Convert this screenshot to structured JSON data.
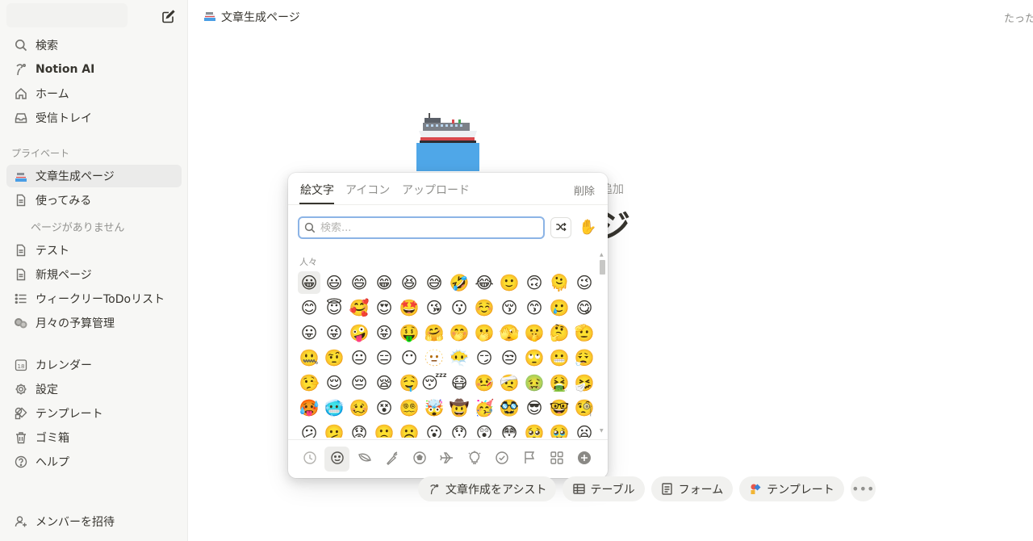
{
  "sidebar": {
    "items": [
      {
        "label": "検索",
        "icon": "search-icon"
      },
      {
        "label": "Notion AI",
        "icon": "notion-ai-icon"
      },
      {
        "label": "ホーム",
        "icon": "home-icon"
      },
      {
        "label": "受信トレイ",
        "icon": "inbox-icon"
      }
    ],
    "private_section": "プライベート",
    "pages": [
      {
        "label": "文章生成ページ",
        "icon": "ship-icon"
      },
      {
        "label": "使ってみる",
        "icon": "page-icon"
      },
      {
        "label": "テスト",
        "icon": "page-icon"
      },
      {
        "label": "新規ページ",
        "icon": "page-icon"
      },
      {
        "label": "ウィークリーToDoリスト",
        "icon": "list-icon"
      },
      {
        "label": "月々の予算管理",
        "icon": "coins-icon"
      }
    ],
    "no_pages": "ページがありません",
    "tools": [
      {
        "label": "カレンダー",
        "icon": "calendar-icon",
        "badge": "18"
      },
      {
        "label": "設定",
        "icon": "gear-icon"
      },
      {
        "label": "テンプレート",
        "icon": "template-icon"
      },
      {
        "label": "ゴミ箱",
        "icon": "trash-icon"
      },
      {
        "label": "ヘルプ",
        "icon": "help-icon"
      }
    ],
    "invite": "メンバーを招待"
  },
  "header": {
    "breadcrumb": "文章生成ページ",
    "right_text": "たった今編集"
  },
  "page": {
    "cover_hint_fragment": "追加",
    "title_fragment": "ジ"
  },
  "picker": {
    "tabs": [
      "絵文字",
      "アイコン",
      "アップロード"
    ],
    "active_tab": 0,
    "remove": "削除",
    "search_placeholder": "検索...",
    "category_label": "人々",
    "emojis": [
      "😀",
      "😃",
      "😄",
      "😁",
      "😆",
      "😅",
      "🤣",
      "😂",
      "🙂",
      "🙃",
      "🫠",
      "😉",
      "😊",
      "😇",
      "🥰",
      "😍",
      "🤩",
      "😘",
      "😗",
      "☺️",
      "😚",
      "😙",
      "🥲",
      "😋",
      "😛",
      "😜",
      "🤪",
      "😝",
      "🤑",
      "🤗",
      "🤭",
      "🫢",
      "🫣",
      "🤫",
      "🤔",
      "🫡",
      "🤐",
      "🤨",
      "😐",
      "😑",
      "😶",
      "🫥",
      "😶‍🌫️",
      "😏",
      "😒",
      "🙄",
      "😬",
      "😮‍💨",
      "🤥",
      "😌",
      "😔",
      "😪",
      "🤤",
      "😴",
      "😷",
      "🤒",
      "🤕",
      "🤢",
      "🤮",
      "🤧",
      "🥵",
      "🥶",
      "🥴",
      "😵",
      "😵‍💫",
      "🤯",
      "🤠",
      "🥳",
      "🥸",
      "😎",
      "🤓",
      "🧐",
      "😕",
      "🫤",
      "😟",
      "🙁",
      "☹️",
      "😮",
      "😯",
      "😲",
      "😳",
      "🥺",
      "🥹",
      "😦"
    ],
    "hand_emoji": "✋",
    "categories": [
      "recent-icon",
      "smiley-icon",
      "leaf-icon",
      "food-icon",
      "ball-icon",
      "plane-icon",
      "bulb-icon",
      "check-icon",
      "flag-icon",
      "grid-icon",
      "plus-circle-icon"
    ]
  },
  "assist": {
    "chips": [
      {
        "label": "文章作成をアシスト",
        "icon": "notion-ai-icon"
      },
      {
        "label": "テーブル",
        "icon": "table-icon"
      },
      {
        "label": "フォーム",
        "icon": "form-icon"
      },
      {
        "label": "テンプレート",
        "icon": "template-color-icon"
      }
    ],
    "more": "•••"
  },
  "colors": {
    "sidebar_bg": "#f7f7f5",
    "active_item": "#ebebea",
    "focus_ring": "#8cb4e6",
    "text": "#37352f",
    "muted": "#91918e"
  }
}
